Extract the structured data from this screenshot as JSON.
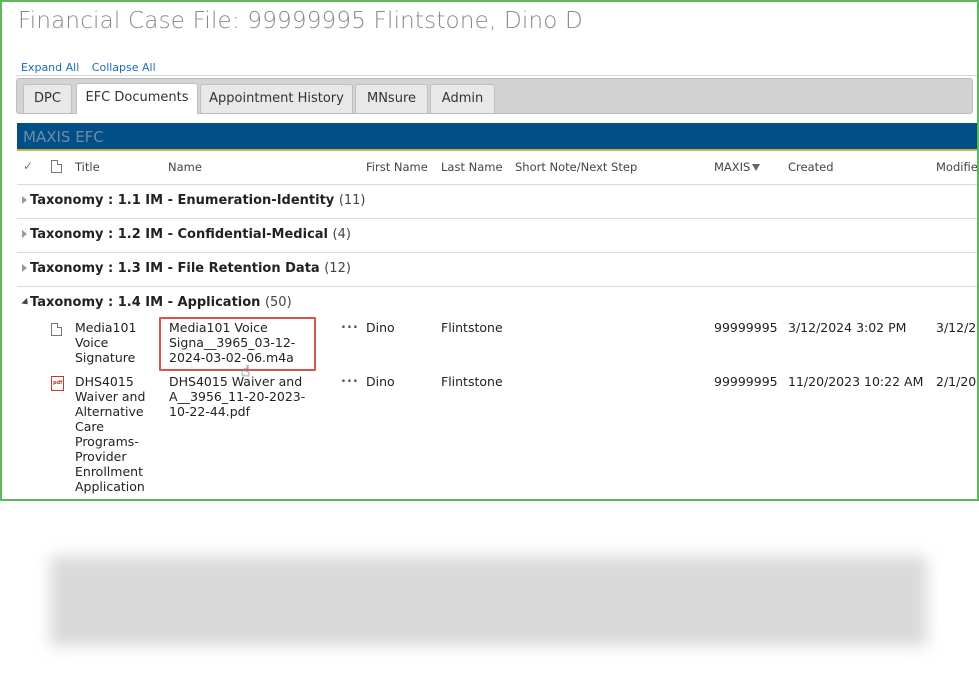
{
  "page": {
    "title": "Financial Case File: 99999995 Flintstone, Dino D"
  },
  "links": {
    "expand_all": "Expand All",
    "collapse_all": "Collapse All"
  },
  "tabs": [
    {
      "label": "DPC",
      "active": false
    },
    {
      "label": "EFC Documents",
      "active": true
    },
    {
      "label": "Appointment History",
      "active": false
    },
    {
      "label": "MNsure",
      "active": false
    },
    {
      "label": "Admin",
      "active": false
    }
  ],
  "section": {
    "title": "MAXIS EFC"
  },
  "columns": {
    "title": "Title",
    "name": "Name",
    "first_name": "First Name",
    "last_name": "Last Name",
    "short_note": "Short Note/Next Step",
    "maxis": "MAXIS",
    "created": "Created",
    "modified": "Modified"
  },
  "icons": {
    "select_all": "check-icon",
    "doc_type": "document-icon",
    "filter": "filter-icon"
  },
  "groups": [
    {
      "label": "Taxonomy : 1.1 IM - Enumeration-Identity",
      "count": "(11)",
      "expanded": false
    },
    {
      "label": "Taxonomy : 1.2 IM - Confidential-Medical",
      "count": "(4)",
      "expanded": false
    },
    {
      "label": "Taxonomy : 1.3 IM - File Retention Data",
      "count": "(12)",
      "expanded": false
    },
    {
      "label": "Taxonomy : 1.4 IM - Application",
      "count": "(50)",
      "expanded": true
    }
  ],
  "rows": [
    {
      "icon": "document-icon",
      "title_lines": [
        "Media101",
        "Voice",
        "Signature"
      ],
      "name_lines": [
        "Media101 Voice",
        "Signa__3965_03-12-",
        "2024-03-02-06.m4a"
      ],
      "menu": "...",
      "first_name": "Dino",
      "last_name": "Flintstone",
      "short_note": "",
      "maxis": "99999995",
      "created": "3/12/2024 3:02 PM",
      "modified": "3/12/2"
    },
    {
      "icon": "pdf-icon",
      "icon_text": "pdf",
      "title_lines": [
        "DHS4015",
        "Waiver and",
        "Alternative",
        "Care",
        "Programs-",
        "Provider",
        "Enrollment",
        "Application"
      ],
      "name_lines": [
        "DHS4015 Waiver and",
        "A__3956_11-20-2023-",
        "10-22-44.pdf"
      ],
      "menu": "...",
      "first_name": "Dino",
      "last_name": "Flintstone",
      "short_note": "",
      "maxis": "99999995",
      "created": "11/20/2023 10:22 AM",
      "modified": "2/1/20"
    }
  ],
  "colors": {
    "frame": "#5cb85c",
    "section_bar": "#004f86",
    "highlight": "#d9534f",
    "link": "#1e6bb8"
  }
}
